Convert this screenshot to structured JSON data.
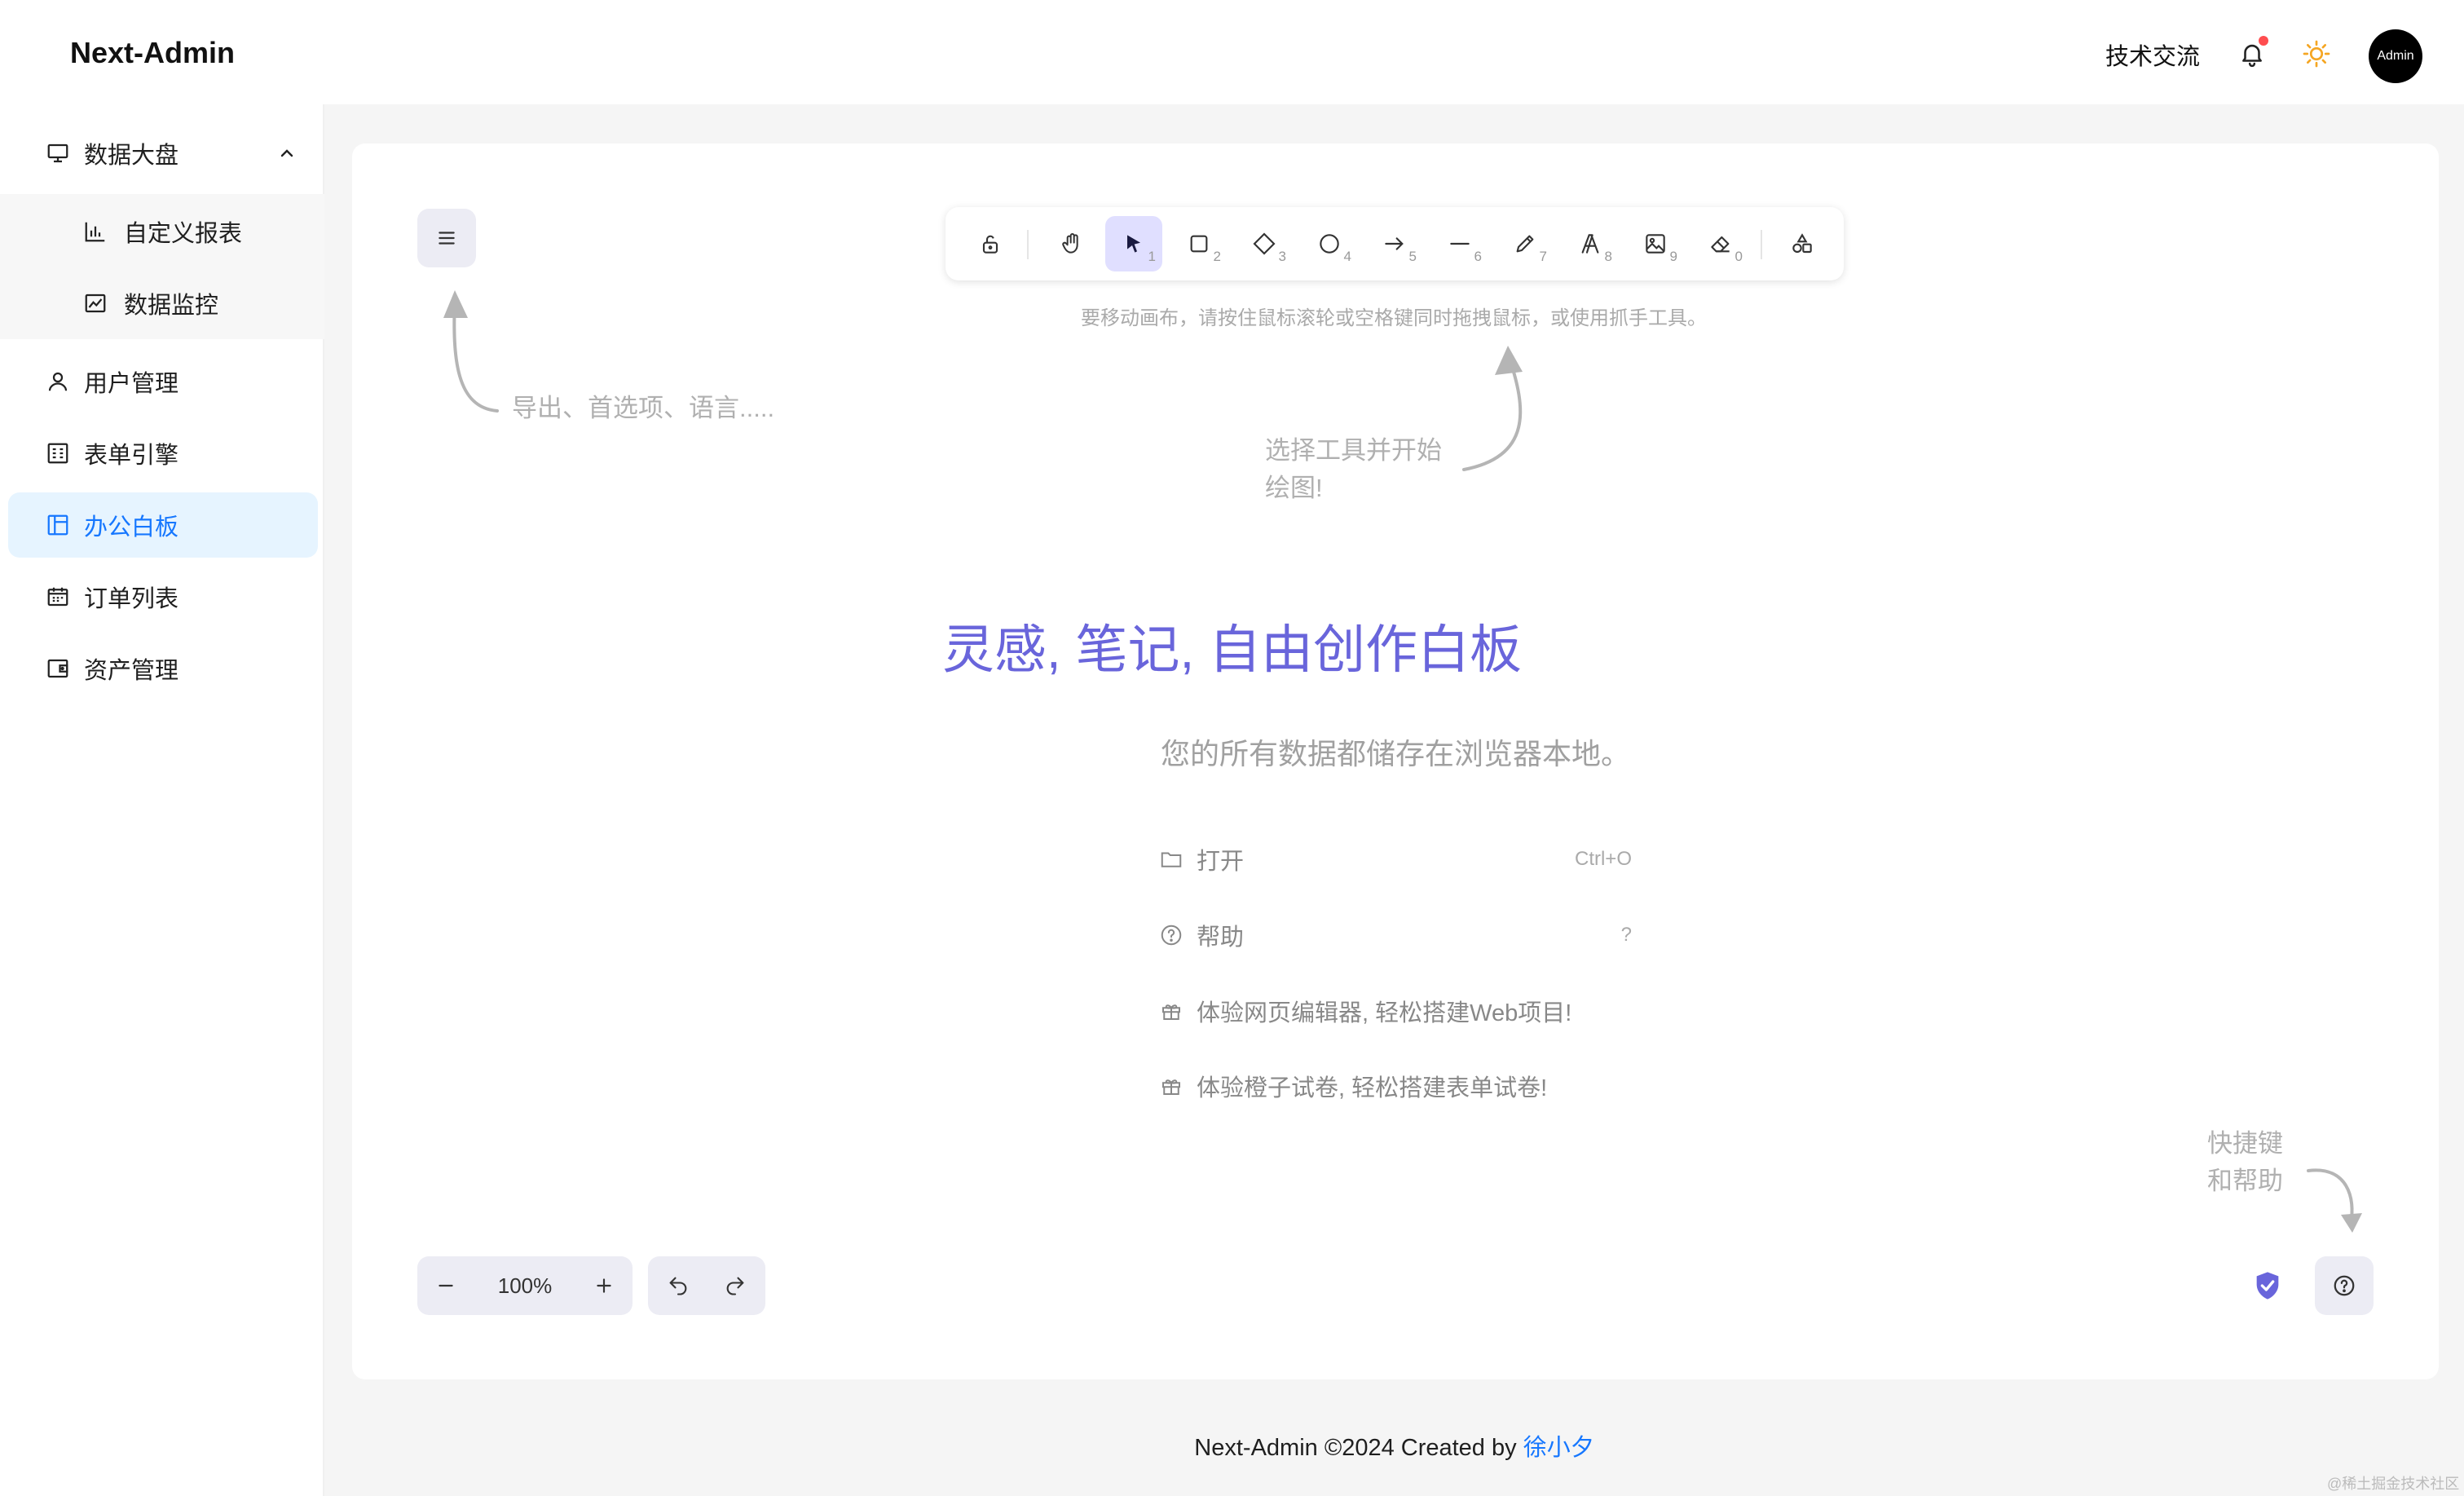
{
  "header": {
    "logo": "Next-Admin",
    "link": "技术交流",
    "avatar_text": "Admin"
  },
  "sidebar": {
    "items": [
      {
        "label": "数据大盘",
        "icon": "monitor-icon",
        "expanded": true
      },
      {
        "label": "自定义报表",
        "icon": "bar-chart-icon"
      },
      {
        "label": "数据监控",
        "icon": "line-chart-icon"
      },
      {
        "label": "用户管理",
        "icon": "user-icon"
      },
      {
        "label": "表单引擎",
        "icon": "form-icon"
      },
      {
        "label": "办公白板",
        "icon": "layout-icon",
        "active": true
      },
      {
        "label": "订单列表",
        "icon": "calendar-icon"
      },
      {
        "label": "资产管理",
        "icon": "wallet-icon"
      }
    ]
  },
  "whiteboard": {
    "toolbar": {
      "tools": [
        {
          "name": "lock",
          "num": ""
        },
        {
          "name": "hand",
          "num": ""
        },
        {
          "name": "selection",
          "num": "1"
        },
        {
          "name": "rectangle",
          "num": "2"
        },
        {
          "name": "diamond",
          "num": "3"
        },
        {
          "name": "ellipse",
          "num": "4"
        },
        {
          "name": "arrow",
          "num": "5"
        },
        {
          "name": "line",
          "num": "6"
        },
        {
          "name": "pencil",
          "num": "7"
        },
        {
          "name": "text",
          "num": "8"
        },
        {
          "name": "image",
          "num": "9"
        },
        {
          "name": "eraser",
          "num": "0"
        },
        {
          "name": "library",
          "num": ""
        }
      ]
    },
    "pan_hint": "要移动画布，请按住鼠标滚轮或空格键同时拖拽鼠标，或使用抓手工具。",
    "menu_hint": "导出、首选项、语言.....",
    "tool_hint_1": "选择工具并开始",
    "tool_hint_2": "绘图!",
    "title": "灵感, 笔记, 自由创作白板",
    "subtitle": "您的所有数据都储存在浏览器本地。",
    "menu": [
      {
        "label": "打开",
        "shortcut": "Ctrl+O",
        "icon": "folder-icon"
      },
      {
        "label": "帮助",
        "shortcut": "?",
        "icon": "help-circle-icon"
      },
      {
        "label": "体验网页编辑器, 轻松搭建Web项目!",
        "shortcut": "",
        "icon": "gift-icon"
      },
      {
        "label": "体验橙子试卷, 轻松搭建表单试卷!",
        "shortcut": "",
        "icon": "gift-icon"
      }
    ],
    "help_hint_1": "快捷键",
    "help_hint_2": "和帮助",
    "zoom": "100%"
  },
  "footer": {
    "text": "Next-Admin ©2024 Created by ",
    "author": "徐小夕"
  },
  "watermark": "@稀土掘金技术社区",
  "colors": {
    "accent": "#6965db",
    "primary": "#1677ff",
    "notify": "#ff4d4f"
  }
}
